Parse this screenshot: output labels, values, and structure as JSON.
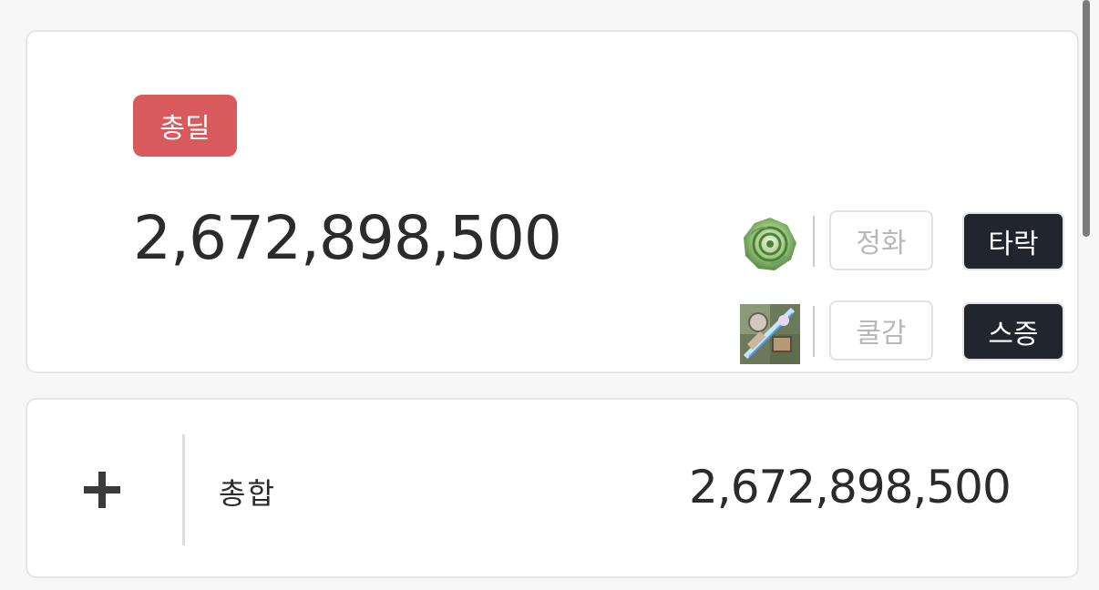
{
  "main_card": {
    "badge_label": "총딜",
    "total_damage": "2,672,898,500",
    "gems": [
      {
        "icon": "green-rose-gem-icon",
        "option_label": "정화",
        "type_label": "타락"
      },
      {
        "icon": "weapon-collage-gem-icon",
        "option_label": "쿨감",
        "type_label": "스증"
      }
    ]
  },
  "summary_card": {
    "expand_icon": "plus-icon",
    "label": "총합",
    "value": "2,672,898,500"
  },
  "colors": {
    "badge_red": "#d95a5d",
    "dark_pill": "#21252e",
    "text": "#2b2b2e"
  }
}
